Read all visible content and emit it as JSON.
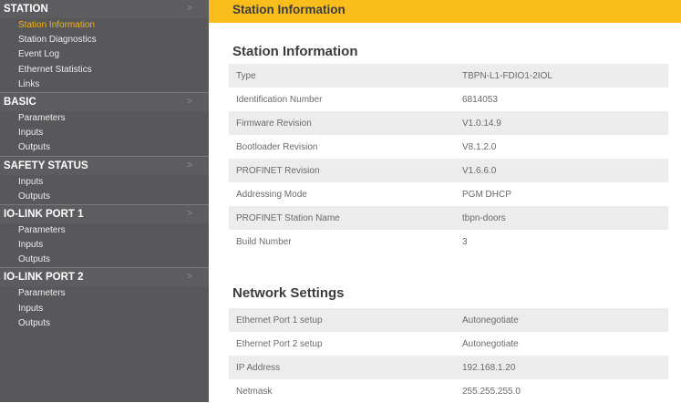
{
  "sidebar": {
    "sections": [
      {
        "title": "STATION",
        "items": [
          "Station Information",
          "Station Diagnostics",
          "Event Log",
          "Ethernet Statistics",
          "Links"
        ],
        "active_index": 0
      },
      {
        "title": "BASIC",
        "items": [
          "Parameters",
          "Inputs",
          "Outputs"
        ]
      },
      {
        "title": "SAFETY STATUS",
        "items": [
          "Inputs",
          "Outputs"
        ]
      },
      {
        "title": "IO-LINK PORT 1",
        "items": [
          "Parameters",
          "Inputs",
          "Outputs"
        ]
      },
      {
        "title": "IO-LINK PORT 2",
        "items": [
          "Parameters",
          "Inputs",
          "Outputs"
        ]
      }
    ],
    "chevron": ">"
  },
  "main": {
    "banner_title": "Station Information",
    "info_title": "Station Information",
    "info_rows": [
      {
        "label": "Type",
        "value": "TBPN-L1-FDIO1-2IOL"
      },
      {
        "label": "Identification Number",
        "value": "6814053"
      },
      {
        "label": "Firmware Revision",
        "value": "V1.0.14.9"
      },
      {
        "label": "Bootloader Revision",
        "value": "V8.1.2.0"
      },
      {
        "label": "PROFINET Revision",
        "value": "V1.6.6.0"
      },
      {
        "label": "Addressing Mode",
        "value": "PGM DHCP"
      },
      {
        "label": "PROFINET Station Name",
        "value": "tbpn-doors"
      },
      {
        "label": "Build Number",
        "value": "3"
      }
    ],
    "network_title": "Network Settings",
    "network_rows": [
      {
        "label": "Ethernet Port 1 setup",
        "value": "Autonegotiate"
      },
      {
        "label": "Ethernet Port 2 setup",
        "value": "Autonegotiate"
      },
      {
        "label": "IP Address",
        "value": "192.168.1.20"
      },
      {
        "label": "Netmask",
        "value": "255.255.255.0"
      }
    ]
  },
  "colors": {
    "sidebar_bg": "#58585a",
    "accent": "#f9bd1c",
    "active_item": "#f5b400"
  }
}
